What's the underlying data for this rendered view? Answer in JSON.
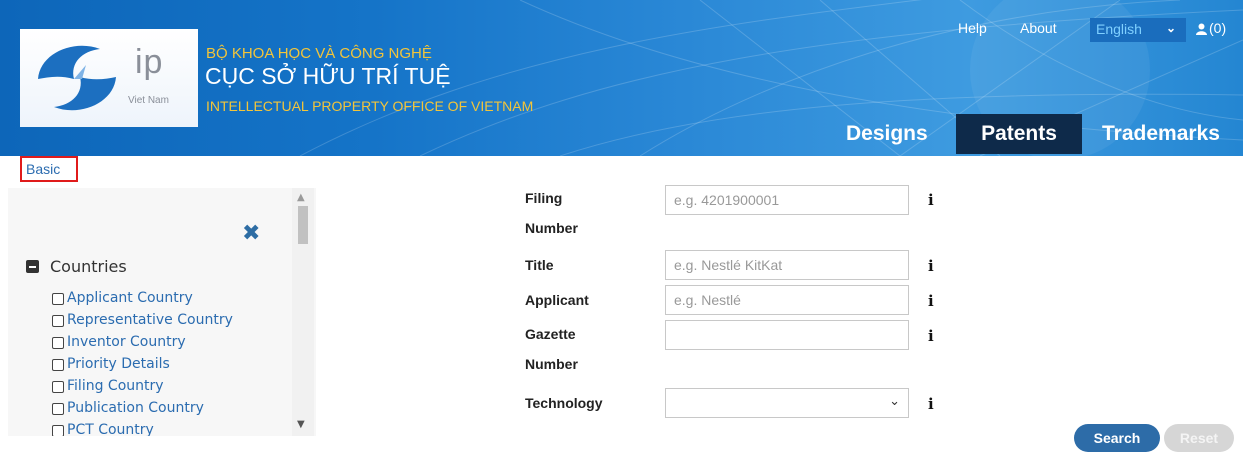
{
  "header": {
    "logo_text": "ip",
    "logo_sub": "Viet Nam",
    "org_line1": "BỘ KHOA HỌC VÀ CÔNG NGHỆ",
    "org_line2": "CỤC SỞ HỮU TRÍ TUỆ",
    "org_line3": "INTELLECTUAL PROPERTY OFFICE OF VIETNAM",
    "help": "Help",
    "about": "About",
    "language": "English",
    "cart": "(0)",
    "nav": [
      {
        "label": "Designs"
      },
      {
        "label": "Patents",
        "active": true
      },
      {
        "label": "Trademarks"
      }
    ]
  },
  "breadcrumb": "Basic",
  "filters": {
    "category": "Countries",
    "options": [
      "Applicant Country",
      "Representative Country",
      "Inventor Country",
      "Priority Details",
      "Filing Country",
      "Publication Country",
      "PCT Country"
    ]
  },
  "form": {
    "fields": [
      {
        "label_line1": "Filing",
        "label_line2": "Number",
        "placeholder": "e.g. 4201900001"
      },
      {
        "label_line1": "Title",
        "placeholder": "e.g. Nestlé KitKat"
      },
      {
        "label_line1": "Applicant",
        "placeholder": "e.g. Nestlé"
      },
      {
        "label_line1": "Gazette",
        "label_line2": "Number",
        "placeholder": ""
      },
      {
        "label_line1": "Technology",
        "value": ""
      }
    ],
    "info_glyph": "i",
    "search": "Search",
    "reset": "Reset"
  },
  "colors": {
    "header_blue": "#1574c8",
    "active_tab": "#0e2a4a",
    "org_gold": "#f3c53a",
    "link_blue": "#2b6cb0",
    "search_btn": "#2d6ca8",
    "crumb_border": "#e01b1b"
  },
  "icons": [
    "close-icon",
    "collapse-icon",
    "info-icon",
    "user-icon",
    "chevron-down-icon"
  ]
}
